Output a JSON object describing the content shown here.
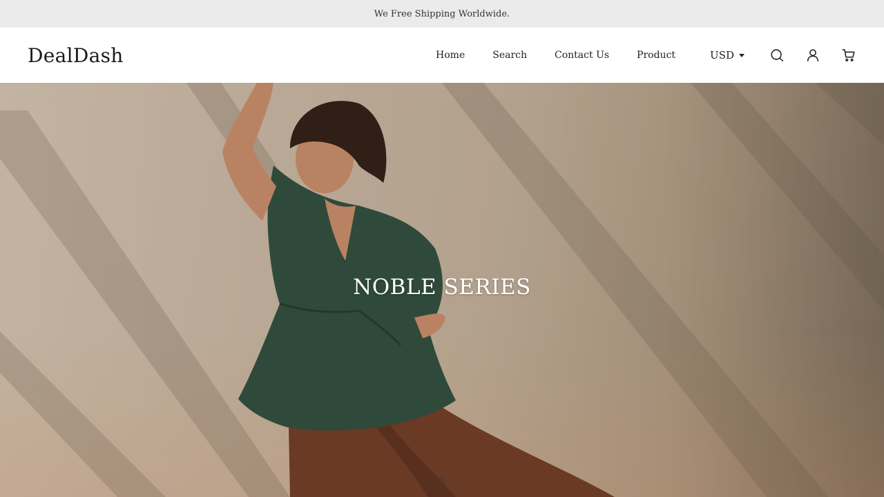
{
  "announcement": {
    "text": "We Free Shipping Worldwide."
  },
  "header": {
    "logo": "DealDash",
    "nav": [
      {
        "label": "Home"
      },
      {
        "label": "Search"
      },
      {
        "label": "Contact Us"
      },
      {
        "label": "Product"
      }
    ],
    "currency": {
      "selected": "USD"
    },
    "icons": [
      "search-icon",
      "account-icon",
      "cart-icon"
    ]
  },
  "hero": {
    "title": "NOBLE SERIES",
    "slides_total": 3,
    "active_slide": 2
  },
  "colors": {
    "announcement_bg": "#ebebeb",
    "header_bg": "#ffffff",
    "hero_wall": "#bcab98",
    "garment_green": "#2f4a3a",
    "trousers_brown": "#6a3a24"
  }
}
